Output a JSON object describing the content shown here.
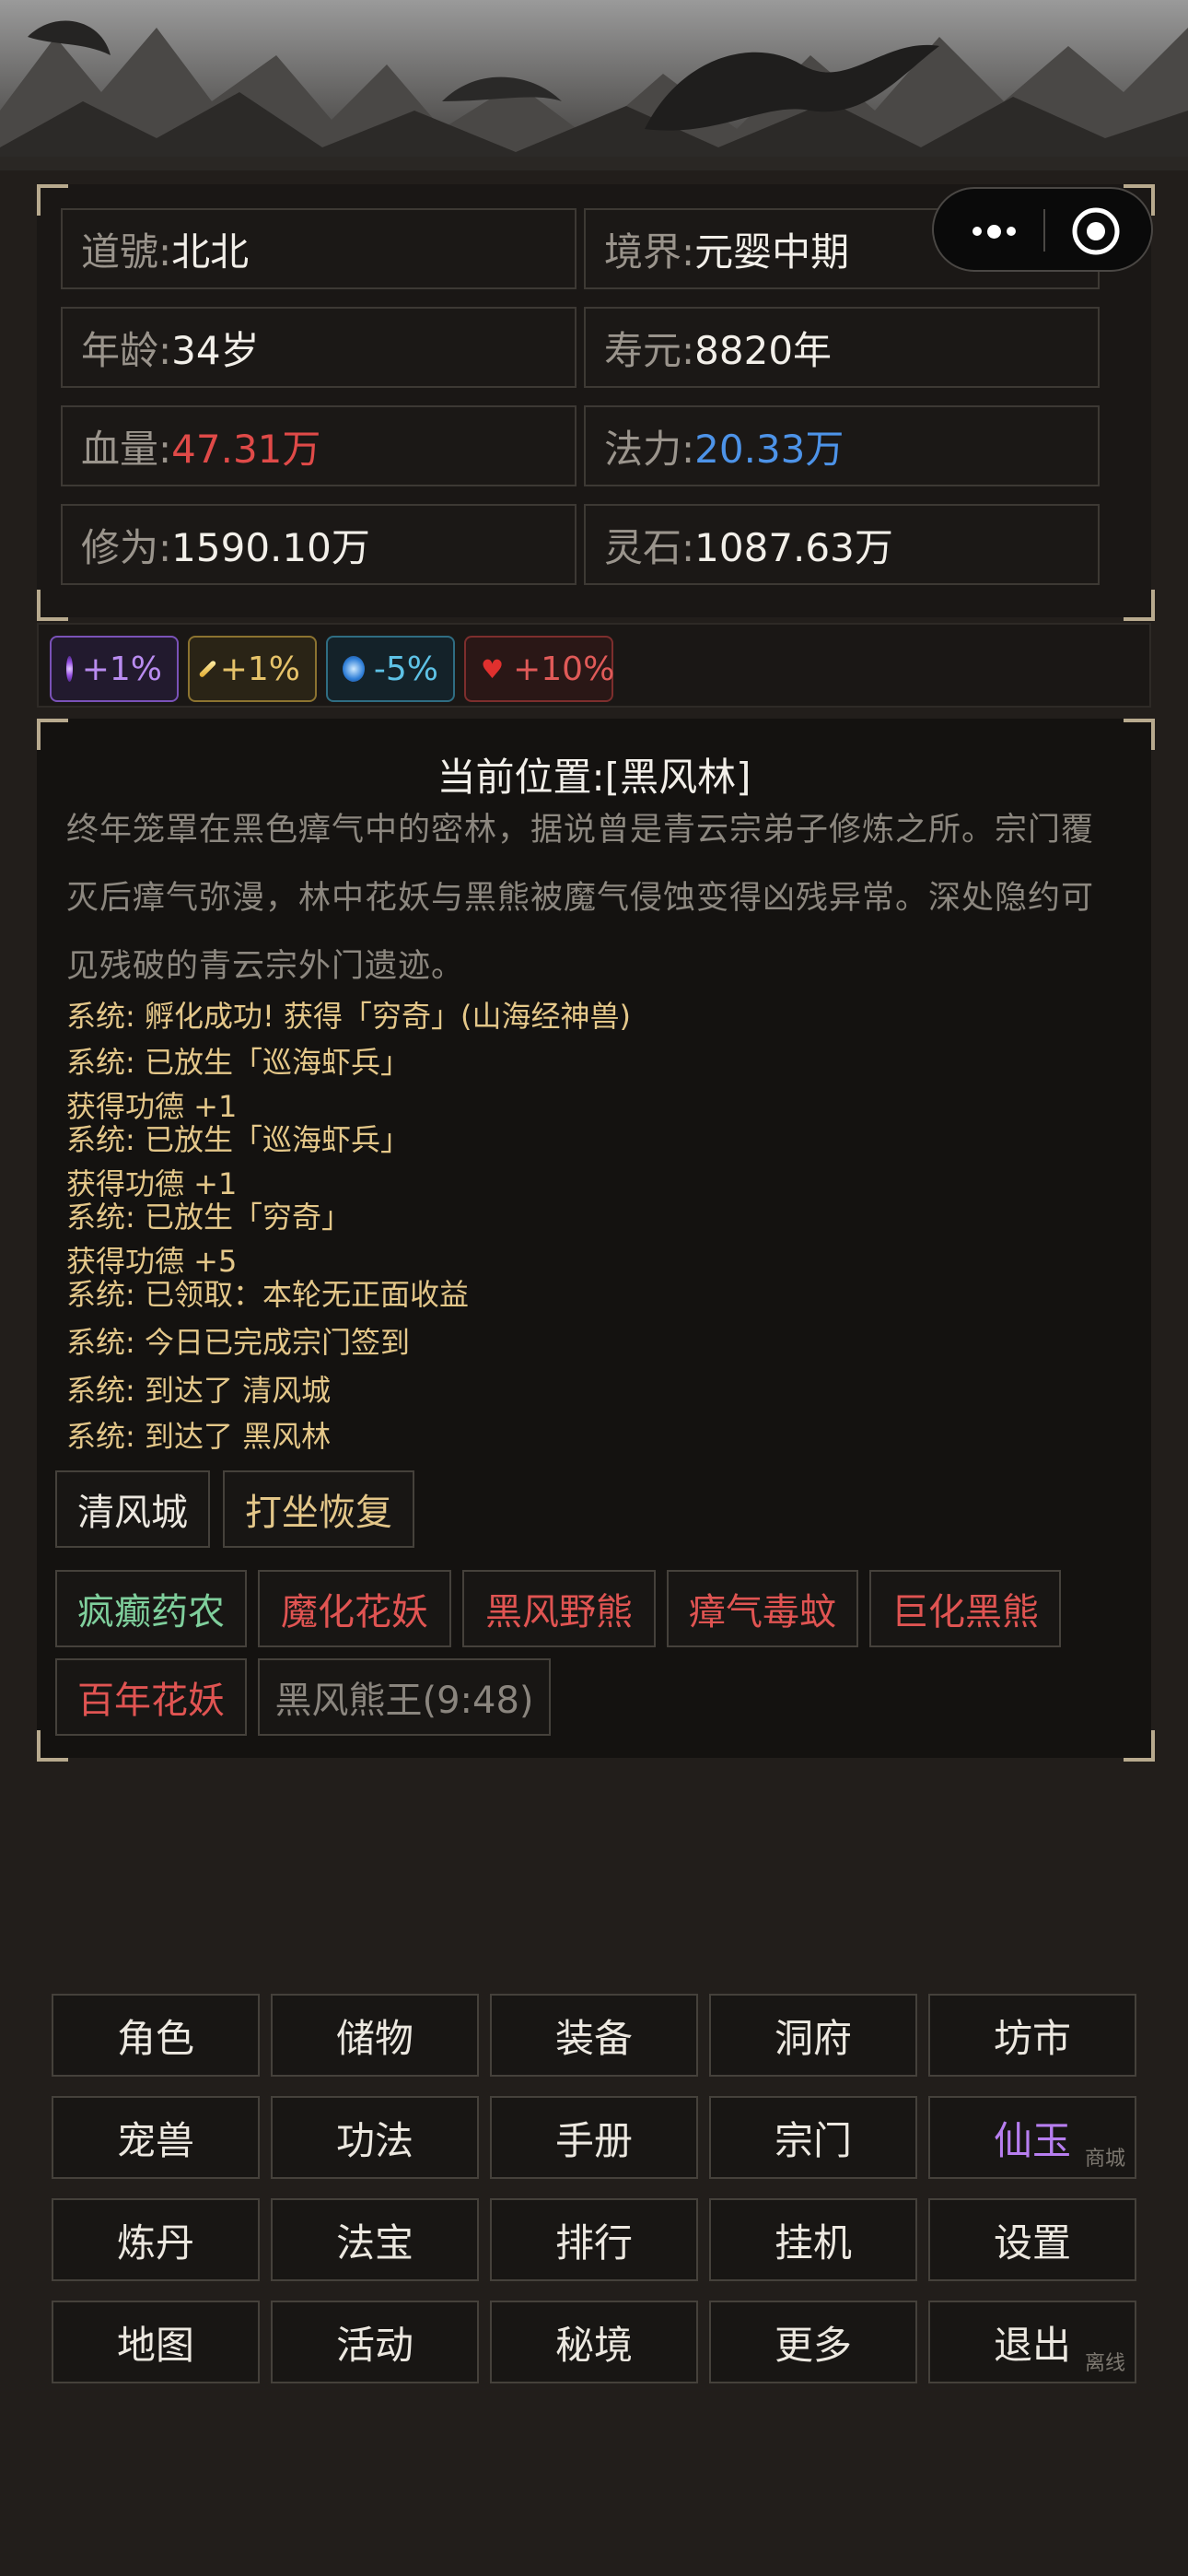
{
  "stats": {
    "daohao": {
      "label": "道號: ",
      "value": "北北"
    },
    "jingjie": {
      "label": "境界: ",
      "value": "元婴中期"
    },
    "age": {
      "label": "年龄: ",
      "value": "34岁"
    },
    "shouyuan": {
      "label": "寿元: ",
      "value": "8820年"
    },
    "hp": {
      "label": "血量: ",
      "value": "47.31万"
    },
    "mana": {
      "label": "法力: ",
      "value": "20.33万"
    },
    "xiuwei": {
      "label": "修为: ",
      "value": "1590.10万"
    },
    "lingshi": {
      "label": "灵石: ",
      "value": "1087.63万"
    }
  },
  "buffs": [
    {
      "icon": "purple-swirl-icon",
      "text": "+1%",
      "color": "#b98cf0",
      "border": "#7a52b8"
    },
    {
      "icon": "gold-gem-icon",
      "text": "+1%",
      "color": "#e6c36a",
      "border": "#8c7330"
    },
    {
      "icon": "blue-orb-icon",
      "text": "-5%",
      "color": "#5ec2e6",
      "border": "#2f6d82"
    },
    {
      "icon": "red-heart-icon",
      "text": "+10%",
      "color": "#e05a58",
      "border": "#7d2e2d"
    }
  ],
  "location": {
    "title": "当前位置:[黑风林]",
    "description": "终年笼罩在黑色瘴气中的密林，据说曾是青云宗弟子修炼之所。宗门覆灭后瘴气弥漫，林中花妖与黑熊被魔气侵蚀变得凶残异常。深处隐约可见残破的青云宗外门遗迹。"
  },
  "log": [
    "系统: 孵化成功! 获得「穷奇」(山海经神兽)",
    "系统: 已放生「巡海虾兵」",
    "获得功德 +1",
    "系统: 已放生「巡海虾兵」",
    "获得功德 +1",
    "系统: 已放生「穷奇」",
    "获得功德 +5",
    "系统: 已领取：本轮无正面收益",
    "系统: 今日已完成宗门签到",
    "系统: 到达了 清风城",
    "系统: 到达了 黑风林"
  ],
  "actions": {
    "travel": "清风城",
    "meditate": "打坐恢复"
  },
  "monsters": [
    {
      "name": "疯癫药农",
      "color": "#7fcf9c"
    },
    {
      "name": "魔化花妖",
      "color": "#e05452"
    },
    {
      "name": "黑风野熊",
      "color": "#e05452"
    },
    {
      "name": "瘴气毒蚊",
      "color": "#e05452"
    },
    {
      "name": "巨化黑熊",
      "color": "#e05452"
    },
    {
      "name": "百年花妖",
      "color": "#e05452"
    },
    {
      "name": "黑风熊王(9:48)",
      "color": "#8a857e"
    }
  ],
  "menu": [
    {
      "label": "角色"
    },
    {
      "label": "储物"
    },
    {
      "label": "装备"
    },
    {
      "label": "洞府"
    },
    {
      "label": "坊市"
    },
    {
      "label": "宠兽"
    },
    {
      "label": "功法"
    },
    {
      "label": "手册"
    },
    {
      "label": "宗门"
    },
    {
      "label": "仙玉",
      "sub": "商城",
      "color": "#b77ef0"
    },
    {
      "label": "炼丹"
    },
    {
      "label": "法宝"
    },
    {
      "label": "排行"
    },
    {
      "label": "挂机"
    },
    {
      "label": "设置"
    },
    {
      "label": "地图"
    },
    {
      "label": "活动"
    },
    {
      "label": "秘境"
    },
    {
      "label": "更多"
    },
    {
      "label": "退出",
      "sub": "离线"
    }
  ]
}
